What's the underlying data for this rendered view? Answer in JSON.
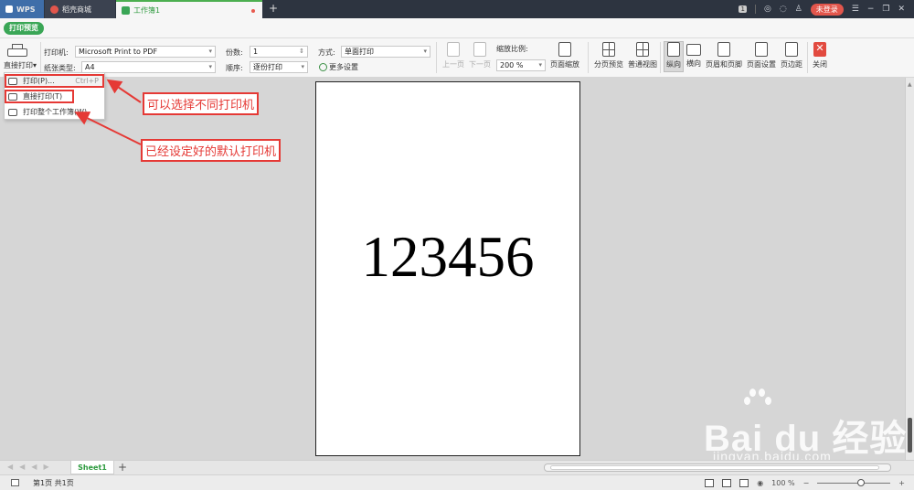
{
  "titlebar": {
    "tabs": [
      {
        "label": "WPS"
      },
      {
        "label": "稻壳商城"
      },
      {
        "label": "工作簿1"
      }
    ],
    "add_tab": "+",
    "badge": "1",
    "login": "未登录"
  },
  "strip": {
    "print_preview": "打印预览"
  },
  "ribbon": {
    "direct_print": "直接打印",
    "printer_label": "打印机:",
    "printer_value": "Microsoft Print to PDF",
    "paper_label": "纸张类型:",
    "paper_value": "A4",
    "copies_label": "份数:",
    "copies_value": "1",
    "order_label": "顺序:",
    "order_value": "逐份打印",
    "mode_label": "方式:",
    "mode_value": "单面打印",
    "more_settings": "更多设置",
    "prev_page": "上一页",
    "next_page": "下一页",
    "zoom_label": "缩放比例:",
    "zoom_value": "200 %",
    "page_scale": "页面缩放",
    "page_break_preview": "分页预览",
    "normal_view": "普通视图",
    "portrait": "纵向",
    "landscape": "横向",
    "header_footer": "页眉和页脚",
    "page_setup": "页面设置",
    "margins": "页边距",
    "close": "关闭"
  },
  "dropdown": {
    "items": [
      {
        "label": "打印(P)...",
        "shortcut": "Ctrl+P"
      },
      {
        "label": "直接打印(T)",
        "shortcut": ""
      },
      {
        "label": "打印整个工作簿(W)",
        "shortcut": ""
      }
    ]
  },
  "annotations": {
    "choose_printer": "可以选择不同打印机",
    "default_printer": "已经设定好的默认打印机"
  },
  "page": {
    "content": "123456"
  },
  "watermark": {
    "brand": "Bai du 经验",
    "url": "jingyan.baidu.com"
  },
  "sheets": {
    "active": "Sheet1",
    "add": "+"
  },
  "status": {
    "page_info": "第1页 共1页",
    "zoom": "100 %"
  }
}
